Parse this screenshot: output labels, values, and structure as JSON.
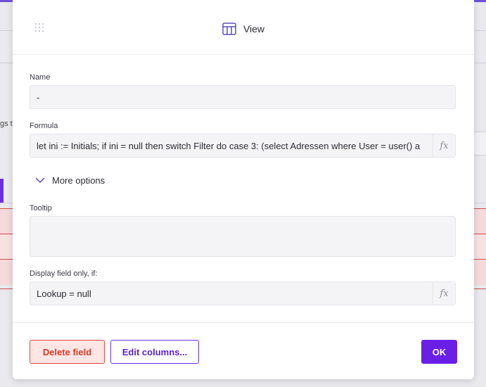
{
  "background": {
    "partial_label": "gs t"
  },
  "modal": {
    "title": "View",
    "title_icon": "table-icon",
    "drag_icon": "drag-handle-icon",
    "name": {
      "label": "Name",
      "value": "-"
    },
    "formula": {
      "label": "Formula",
      "value": "let ini := Initials; if ini = null then switch Filter do case 3: (select Adressen where User = user() a",
      "fx_label": "fx"
    },
    "more_options": {
      "label": "More options",
      "icon": "chevron-down-icon"
    },
    "tooltip": {
      "label": "Tooltip",
      "value": ""
    },
    "display_if": {
      "label": "Display field only, if:",
      "value": "Lookup = null",
      "fx_label": "fx"
    },
    "buttons": {
      "delete": "Delete field",
      "edit_columns": "Edit columns...",
      "ok": "OK"
    }
  },
  "colors": {
    "accent": "#6a1fe6",
    "danger": "#e8463a",
    "danger_bg": "#fde6e3"
  }
}
